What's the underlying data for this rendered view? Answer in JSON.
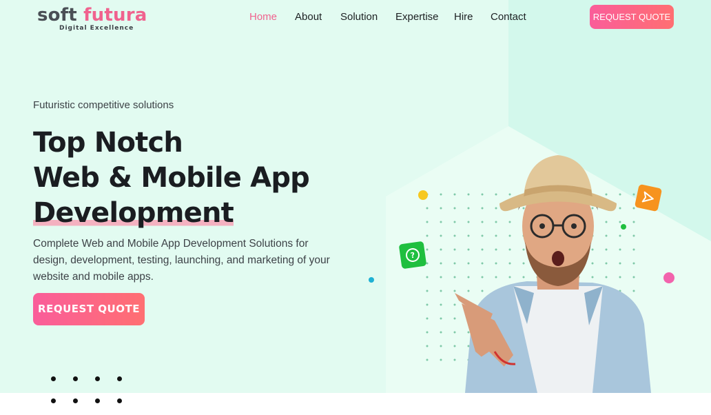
{
  "brand": {
    "name_part1": "soft",
    "name_part2": "futura",
    "tagline": "Digital Excellence"
  },
  "nav": {
    "items": [
      {
        "label": "Home",
        "active": true
      },
      {
        "label": "About",
        "active": false
      },
      {
        "label": "Solution",
        "active": false
      },
      {
        "label": "Expertise",
        "active": false
      },
      {
        "label": "Hire",
        "active": false
      },
      {
        "label": "Contact",
        "active": false
      }
    ],
    "cta_label": "REQUEST QUOTE"
  },
  "hero": {
    "eyebrow": "Futuristic competitive solutions",
    "headline_line1": "Top Notch",
    "headline_line2": "Web & Mobile App",
    "headline_line3": "Development",
    "description": "Complete Web and Mobile App Development Solutions for design, development, testing, launching, and marketing of your website and mobile apps.",
    "cta_label": "REQUEST QUOTE"
  },
  "illustration": {
    "subject": "surprised man in hat pointing",
    "badges": [
      {
        "icon": "question-chat-icon",
        "color": "#1fbf3f"
      },
      {
        "icon": "send-icon",
        "color": "#f7931e"
      }
    ]
  },
  "colors": {
    "accent": "#f0628e",
    "gradient_start": "#fa5d9a",
    "gradient_end": "#ff6f72",
    "hero_bg": "#e2fbf1",
    "text_dark": "#1a1d21"
  }
}
